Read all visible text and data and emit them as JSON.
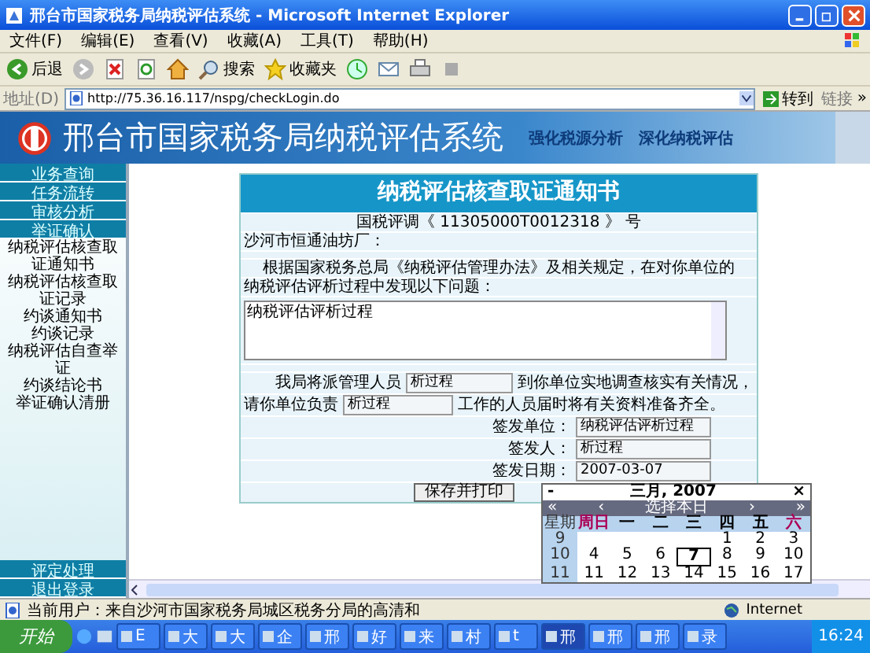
{
  "window": {
    "title": "邢台市国家税务局纳税评估系统 - Microsoft Internet Explorer"
  },
  "menu": [
    "文件(F)",
    "编辑(E)",
    "查看(V)",
    "收藏(A)",
    "工具(T)",
    "帮助(H)"
  ],
  "toolbar": {
    "back": "后退",
    "search": "搜索",
    "favorites": "收藏夹"
  },
  "address": {
    "label": "地址(D)",
    "url": "http://75.36.16.117/nspg/checkLogin.do",
    "go": "转到",
    "links": "链接",
    "more": "»"
  },
  "banner": {
    "title": "邢台市国家税务局纳税评估系统",
    "slogans": [
      "强化税源分析",
      "深化纳税评估"
    ]
  },
  "sidebar": {
    "top": [
      "业务查询",
      "任务流转",
      "审核分析",
      "举证确认"
    ],
    "links": [
      "纳税评估核查取证通知书",
      "纳税评估核查取证记录",
      "约谈通知书",
      "约谈记录",
      "纳税评估自查举证",
      "约谈结论书",
      "举证确认清册"
    ],
    "bottom": [
      "评定处理",
      "退出登录"
    ]
  },
  "form": {
    "title": "纳税评估核查取证通知书",
    "number": "国税评调《 11305000T0012318 》 号",
    "addressee": "沙河市恒通油坊厂：",
    "lines": [
      "根据国家税务总局《纳税评估管理办法》及相关规定，在对你单位的",
      "纳税评估评析过程中发现以下问题："
    ],
    "problems": "纳税评估评析过程",
    "visit": {
      "before": "我局将派管理人员",
      "value": "析过程",
      "after": "到你单位实地调查核实有关情况，"
    },
    "prepare": {
      "before": "请你单位负责",
      "value": "析过程",
      "after": "工作的人员届时将有关资料准备齐全。"
    },
    "signature": [
      {
        "label": "签发单位：",
        "value": "纳税评估评析过程"
      },
      {
        "label": "签发人：",
        "value": "析过程"
      },
      {
        "label": "签发日期：",
        "value": "2007-03-07"
      }
    ],
    "button": "保存并打印"
  },
  "calendar": {
    "close_left": "-",
    "title": "三月, 2007",
    "close": "×",
    "nav": [
      "«",
      "‹",
      "选择本日",
      "›",
      "»"
    ],
    "week_header": "星期",
    "weekdays": [
      "周日",
      "一",
      "二",
      "三",
      "四",
      "五",
      "六"
    ],
    "weeks": [
      {
        "week": "9",
        "days": [
          {
            "day": "1",
            "selected": false
          },
          {
            "day": "2",
            "selected": false
          },
          {
            "day": "3",
            "selected": false
          }
        ]
      },
      {
        "week": "10",
        "days": [
          {
            "day": "4",
            "selected": false
          },
          {
            "day": "5",
            "selected": false
          },
          {
            "day": "6",
            "selected": false
          },
          {
            "day": "7",
            "selected": true
          },
          {
            "day": "8",
            "selected": false
          },
          {
            "day": "9",
            "selected": false
          },
          {
            "day": "10",
            "selected": false
          }
        ]
      },
      {
        "week": "11",
        "days": [
          {
            "day": "11",
            "selected": false
          },
          {
            "day": "12",
            "selected": false
          },
          {
            "day": "13",
            "selected": false
          },
          {
            "day": "14",
            "selected": false
          },
          {
            "day": "15",
            "selected": false
          },
          {
            "day": "16",
            "selected": false
          },
          {
            "day": "17",
            "selected": false
          }
        ]
      }
    ]
  },
  "status_bar": {
    "text": "当前用户：来自沙河市国家税务局城区税务分局的高清和",
    "zone": "Internet"
  },
  "taskbar": {
    "start": "开始",
    "buttons": [
      {
        "label": "E",
        "selected": false
      },
      {
        "label": "大",
        "selected": false
      },
      {
        "label": "大",
        "selected": false
      },
      {
        "label": "企",
        "selected": false
      },
      {
        "label": "邢",
        "selected": false
      },
      {
        "label": "好",
        "selected": false
      },
      {
        "label": "来",
        "selected": false
      },
      {
        "label": "村",
        "selected": false
      },
      {
        "label": "t",
        "selected": false
      },
      {
        "label": "邢",
        "selected": true
      },
      {
        "label": "邢",
        "selected": false
      },
      {
        "label": "邢",
        "selected": false
      },
      {
        "label": "录",
        "selected": false
      }
    ],
    "clock": "16:24"
  }
}
